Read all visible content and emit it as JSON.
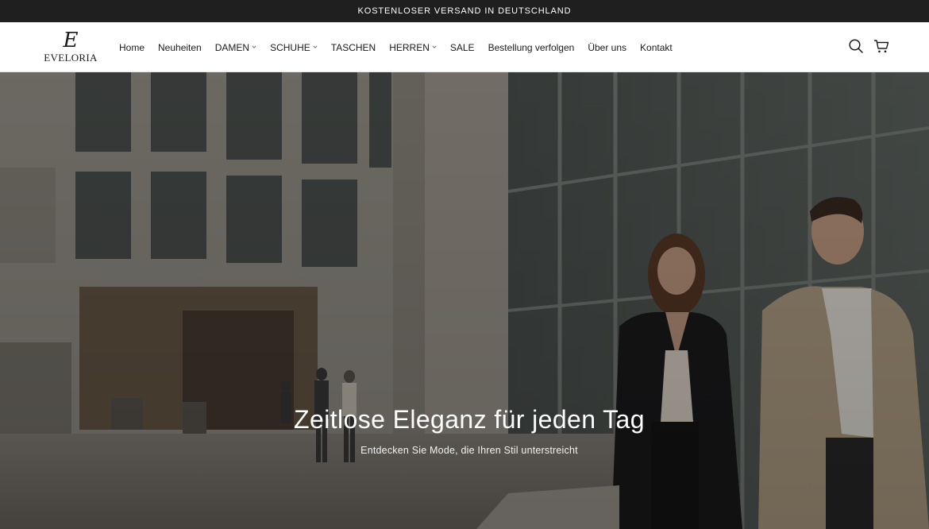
{
  "announcement": {
    "text": "KOSTENLOSER VERSAND IN DEUTSCHLAND"
  },
  "brand": {
    "mark": "E",
    "name": "EVELORIA"
  },
  "nav": {
    "items": [
      {
        "label": "Home",
        "has_dropdown": false
      },
      {
        "label": "Neuheiten",
        "has_dropdown": false
      },
      {
        "label": "DAMEN",
        "has_dropdown": true
      },
      {
        "label": "SCHUHE",
        "has_dropdown": true
      },
      {
        "label": "TASCHEN",
        "has_dropdown": false
      },
      {
        "label": "HERREN",
        "has_dropdown": true
      },
      {
        "label": "SALE",
        "has_dropdown": false
      },
      {
        "label": "Bestellung verfolgen",
        "has_dropdown": false
      },
      {
        "label": "Über uns",
        "has_dropdown": false
      },
      {
        "label": "Kontakt",
        "has_dropdown": false
      }
    ]
  },
  "header_icons": [
    "search-icon",
    "cart-icon"
  ],
  "hero": {
    "title": "Zeitlose Eleganz für jeden Tag",
    "subtitle": "Entdecken Sie Mode, die Ihren Stil unterstreicht",
    "image_description_icon": "hero-image"
  },
  "colors": {
    "announcement_bg": "#1f1f1f",
    "text": "#1a1a1a",
    "hero_overlay": "#000000"
  }
}
